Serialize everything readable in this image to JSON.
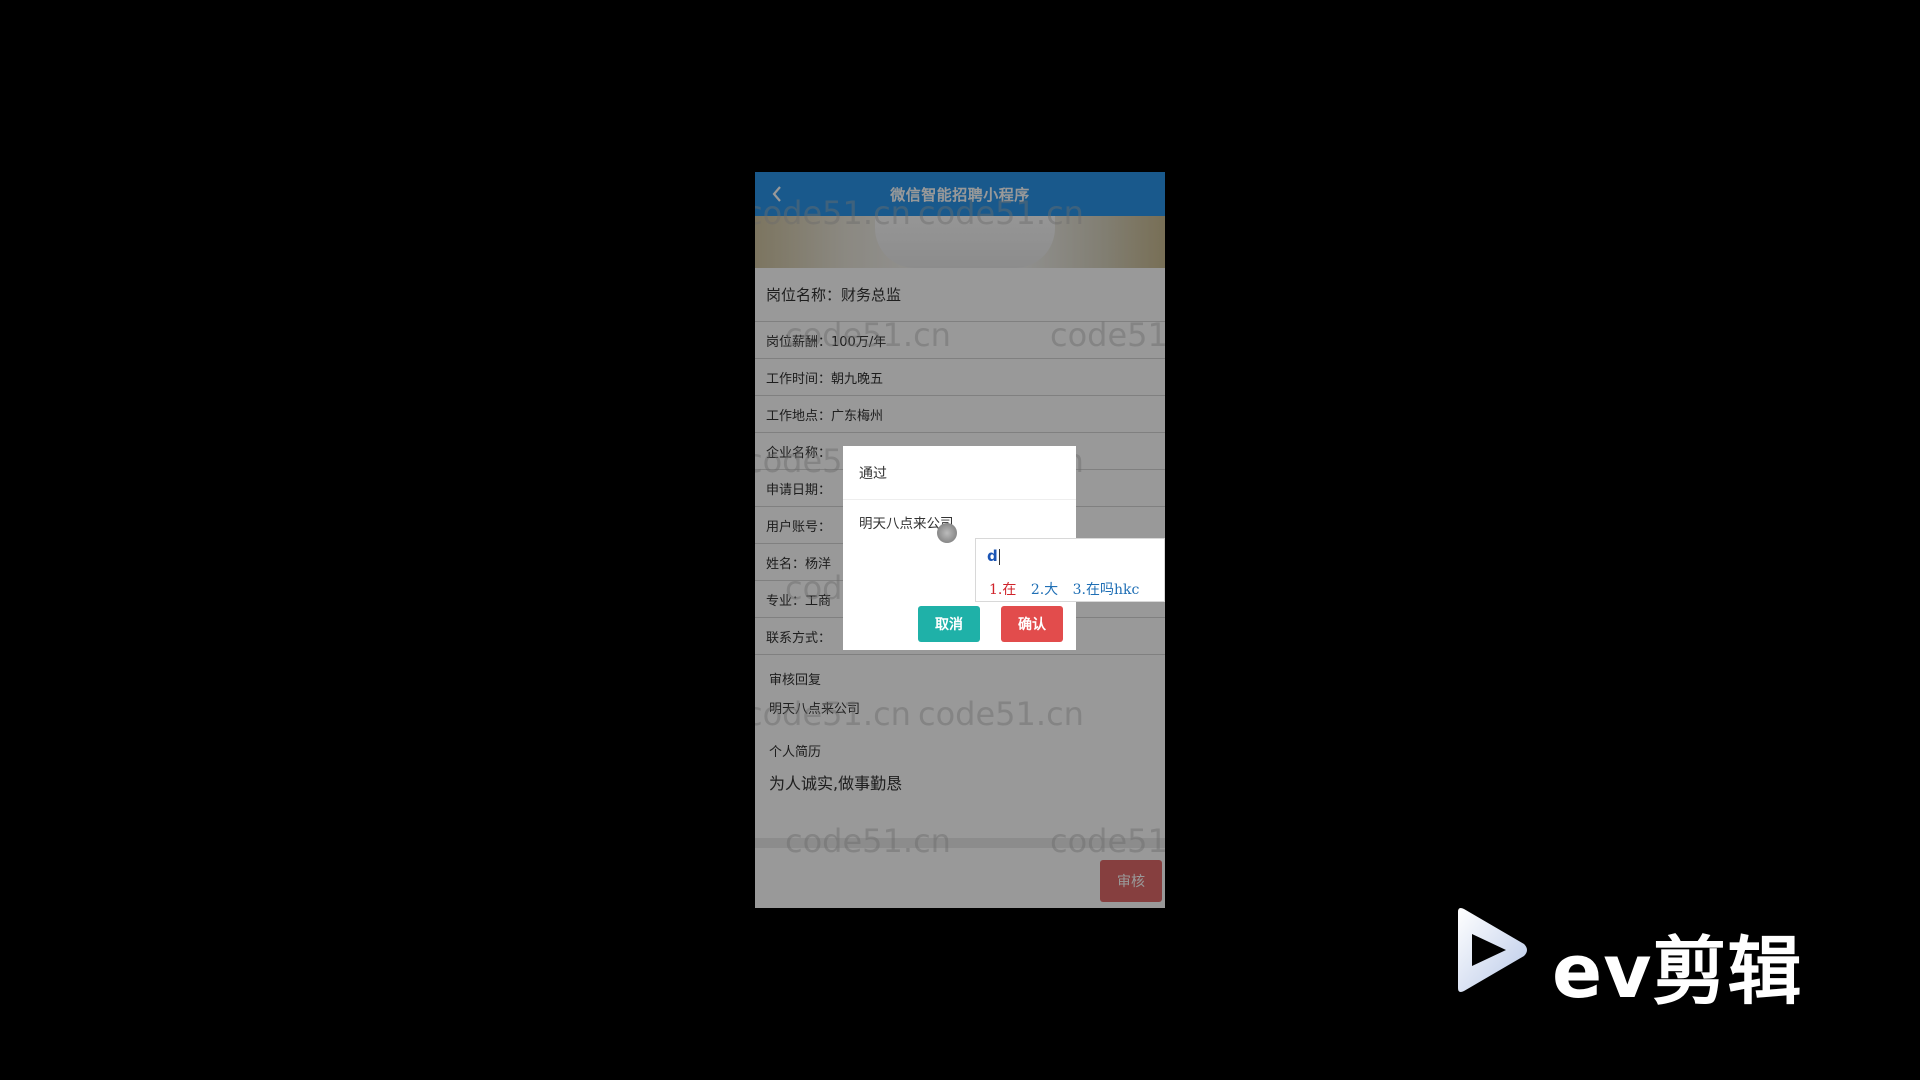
{
  "navbar": {
    "title": "微信智能招聘小程序",
    "back_icon": "chevron-left-icon"
  },
  "job": {
    "position": {
      "label": "岗位名称：",
      "value": "财务总监"
    },
    "salary": {
      "label": "岗位薪酬：",
      "value": "100万/年"
    },
    "hours": {
      "label": "工作时间：",
      "value": "朝九晚五"
    },
    "location": {
      "label": "工作地点：",
      "value": "广东梅州"
    },
    "company": {
      "label": "企业名称：",
      "value": ""
    },
    "apply_date": {
      "label": "申请日期：",
      "value": ""
    },
    "account": {
      "label": "用户账号：",
      "value": ""
    },
    "name": {
      "label": "姓名：",
      "value": "杨洋"
    },
    "major": {
      "label": "专业：",
      "value": "工商"
    },
    "contact": {
      "label": "联系方式：",
      "value": ""
    }
  },
  "review_reply": {
    "label": "审核回复",
    "value": "明天八点来公司"
  },
  "resume": {
    "label": "个人简历",
    "value": "为人诚实,做事勤恳"
  },
  "review_button": "审核",
  "dialog": {
    "status": "通过",
    "reply_text": "明天八点来公司",
    "cancel_label": "取消",
    "confirm_label": "确认"
  },
  "ime": {
    "composition": "d",
    "candidates": [
      "1.在",
      "2.大",
      "3.在吗hkc"
    ]
  },
  "watermark": "code51.cn",
  "logo": {
    "text": "ev剪辑",
    "icon": "play-icon"
  },
  "colors": {
    "navbar": "#2b95ea",
    "cancel": "#1fb1a8",
    "confirm": "#e24c4c",
    "review": "#e06a6a"
  }
}
